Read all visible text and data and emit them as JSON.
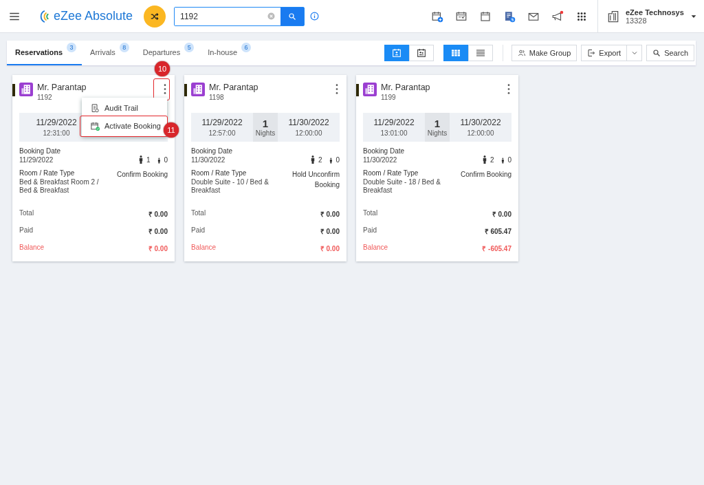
{
  "header": {
    "app_name": "eZee Absolute",
    "search": {
      "value": "1192"
    },
    "property": {
      "name": "eZee Technosys",
      "id": "13328"
    }
  },
  "tabs": [
    {
      "label": "Reservations",
      "count": "3",
      "selected": true
    },
    {
      "label": "Arrivals",
      "count": "8",
      "selected": false
    },
    {
      "label": "Departures",
      "count": "5",
      "selected": false
    },
    {
      "label": "In-house",
      "count": "6",
      "selected": false
    }
  ],
  "toolbar": {
    "calendar_views": [
      {
        "kind": "arrival",
        "selected": true
      },
      {
        "kind": "guest",
        "selected": false
      }
    ],
    "layouts": [
      {
        "kind": "grid",
        "selected": true
      },
      {
        "kind": "list",
        "selected": false
      }
    ],
    "buttons": [
      {
        "kind": "group",
        "label": "Make Group"
      },
      {
        "kind": "export",
        "label": "Export"
      },
      {
        "kind": "search",
        "label": "Search"
      }
    ]
  },
  "cards": [
    {
      "name": "Mr. Parantap",
      "number": "1192",
      "arrival_date": "11/29/2022",
      "arrival_time": "12:31:00",
      "booking_date_label": "Booking Date",
      "booking_date": "11/29/2022",
      "adults": "1",
      "children": "0",
      "room_label": "Room / Rate Type",
      "room": "Bed & Breakfast Room 2 / Bed & Breakfast",
      "status": "Confirm Booking",
      "total_label": "Total",
      "total": "₹ 0.00",
      "paid_label": "Paid",
      "paid": "₹ 0.00",
      "balance_label": "Balance",
      "balance": "₹ 0.00",
      "menu_annotation": "10",
      "menu": [
        {
          "kind": "audit",
          "label": "Audit Trail"
        },
        {
          "kind": "activate",
          "label": "Activate Booking",
          "annotation": "11"
        }
      ]
    },
    {
      "name": "Mr. Parantap",
      "number": "1198",
      "arrival_date": "11/29/2022",
      "arrival_time": "12:57:00",
      "nights": "1",
      "nights_label": "Nights",
      "departure_date": "11/30/2022",
      "departure_time": "12:00:00",
      "booking_date_label": "Booking Date",
      "booking_date": "11/30/2022",
      "adults": "2",
      "children": "0",
      "room_label": "Room / Rate Type",
      "room": "Double Suite - 10 / Bed & Breakfast",
      "status": "Hold Unconfirm Booking",
      "total_label": "Total",
      "total": "₹ 0.00",
      "paid_label": "Paid",
      "paid": "₹ 0.00",
      "balance_label": "Balance",
      "balance": "₹ 0.00"
    },
    {
      "name": "Mr. Parantap",
      "number": "1199",
      "arrival_date": "11/29/2022",
      "arrival_time": "13:01:00",
      "nights": "1",
      "nights_label": "Nights",
      "departure_date": "11/30/2022",
      "departure_time": "12:00:00",
      "booking_date_label": "Booking Date",
      "booking_date": "11/30/2022",
      "adults": "2",
      "children": "0",
      "room_label": "Room / Rate Type",
      "room": "Double Suite - 18 / Bed & Breakfast",
      "status": "Confirm Booking",
      "total_label": "Total",
      "total": "₹ 0.00",
      "paid_label": "Paid",
      "paid": "₹ 605.47",
      "balance_label": "Balance",
      "balance": "₹ -605.47"
    }
  ]
}
